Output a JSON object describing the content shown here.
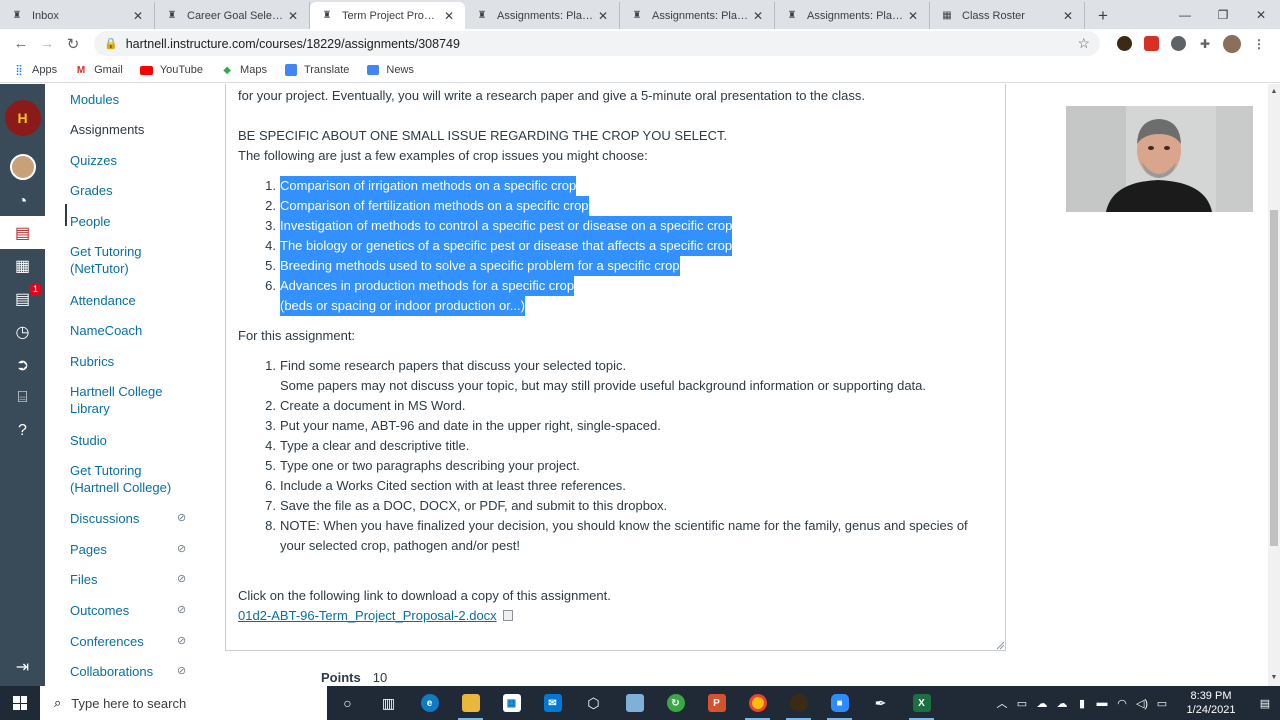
{
  "browser": {
    "tabs": [
      {
        "label": "Inbox",
        "icon": "canvas-icon",
        "active": false
      },
      {
        "label": "Career Goal Selection",
        "icon": "canvas-icon",
        "active": false
      },
      {
        "label": "Term Project Proposal",
        "icon": "canvas-icon",
        "active": true
      },
      {
        "label": "Assignments: Plant Sci",
        "icon": "canvas-icon",
        "active": false
      },
      {
        "label": "Assignments: Plant Sci",
        "icon": "canvas-icon",
        "active": false
      },
      {
        "label": "Assignments: Plant Sci",
        "icon": "canvas-icon",
        "active": false
      },
      {
        "label": "Class Roster",
        "icon": "roster-icon",
        "active": false
      }
    ],
    "url": "hartnell.instructure.com/courses/18229/assignments/308749",
    "bookmarks": [
      "Apps",
      "Gmail",
      "YouTube",
      "Maps",
      "Translate",
      "News"
    ]
  },
  "global_nav": {
    "inbox_badge": "1"
  },
  "course_nav": {
    "items": [
      {
        "label": "Modules"
      },
      {
        "label": "Assignments",
        "active": true
      },
      {
        "label": "Quizzes"
      },
      {
        "label": "Grades"
      },
      {
        "label": "People"
      },
      {
        "label": "Get Tutoring\n(NetTutor)"
      },
      {
        "label": "Attendance"
      },
      {
        "label": "NameCoach"
      },
      {
        "label": "Rubrics"
      },
      {
        "label": "Hartnell College\nLibrary"
      },
      {
        "label": "Studio"
      },
      {
        "label": "Get Tutoring\n(Hartnell College)"
      },
      {
        "label": "Discussions",
        "hidden": true
      },
      {
        "label": "Pages",
        "hidden": true
      },
      {
        "label": "Files",
        "hidden": true
      },
      {
        "label": "Outcomes",
        "hidden": true
      },
      {
        "label": "Conferences",
        "hidden": true
      },
      {
        "label": "Collaborations",
        "hidden": true
      }
    ]
  },
  "assignment": {
    "intro_line": "for your project. Eventually, you will write a research paper and give a 5-minute oral presentation to the class.",
    "specific_heading": "BE SPECIFIC ABOUT ONE SMALL ISSUE REGARDING THE CROP YOU SELECT.",
    "examples_intro": "The following are just a few examples of crop issues you might choose:",
    "examples": [
      "Comparison of irrigation methods on a specific crop",
      "Comparison of fertilization methods on a specific crop",
      "Investigation of methods to control a specific pest or disease on a specific crop",
      "The biology or genetics of a specific pest or disease that affects a specific crop",
      "Breeding methods used to solve a specific problem for a specific crop",
      "Advances in production methods for a specific crop"
    ],
    "examples_continuation": "(beds or spacing or indoor production or...)",
    "for_assignment": "For this assignment:",
    "steps": [
      "Find some research papers that discuss your selected topic.",
      "Create a document in MS Word.",
      "Put your name, ABT-96 and date in the upper right, single-spaced.",
      "Type a clear and descriptive title.",
      "Type one or two paragraphs describing your project.",
      "Include a Works Cited section with at least three references.",
      "Save the file as a DOC, DOCX, or PDF, and submit to this dropbox.",
      "NOTE: When you have finalized your decision, you should know the scientific name for the family, genus and species of"
    ],
    "step1_continuation": "Some papers may not discuss your topic, but may still provide useful background information or supporting data.",
    "step8_continuation": "your selected crop, pathogen and/or pest!",
    "download_text": "Click on the following link to download a copy of this assignment.",
    "download_link": "01d2-ABT-96-Term_Project_Proposal-2.docx",
    "points_label": "Points",
    "points_value": "10"
  },
  "taskbar": {
    "search_placeholder": "Type here to search",
    "time": "8:39 PM",
    "date": "1/24/2021"
  },
  "colors": {
    "canvas_nav": "#394b58",
    "link": "#0770a3",
    "selection": "#3390ff",
    "taskbar": "#1f2a36"
  }
}
